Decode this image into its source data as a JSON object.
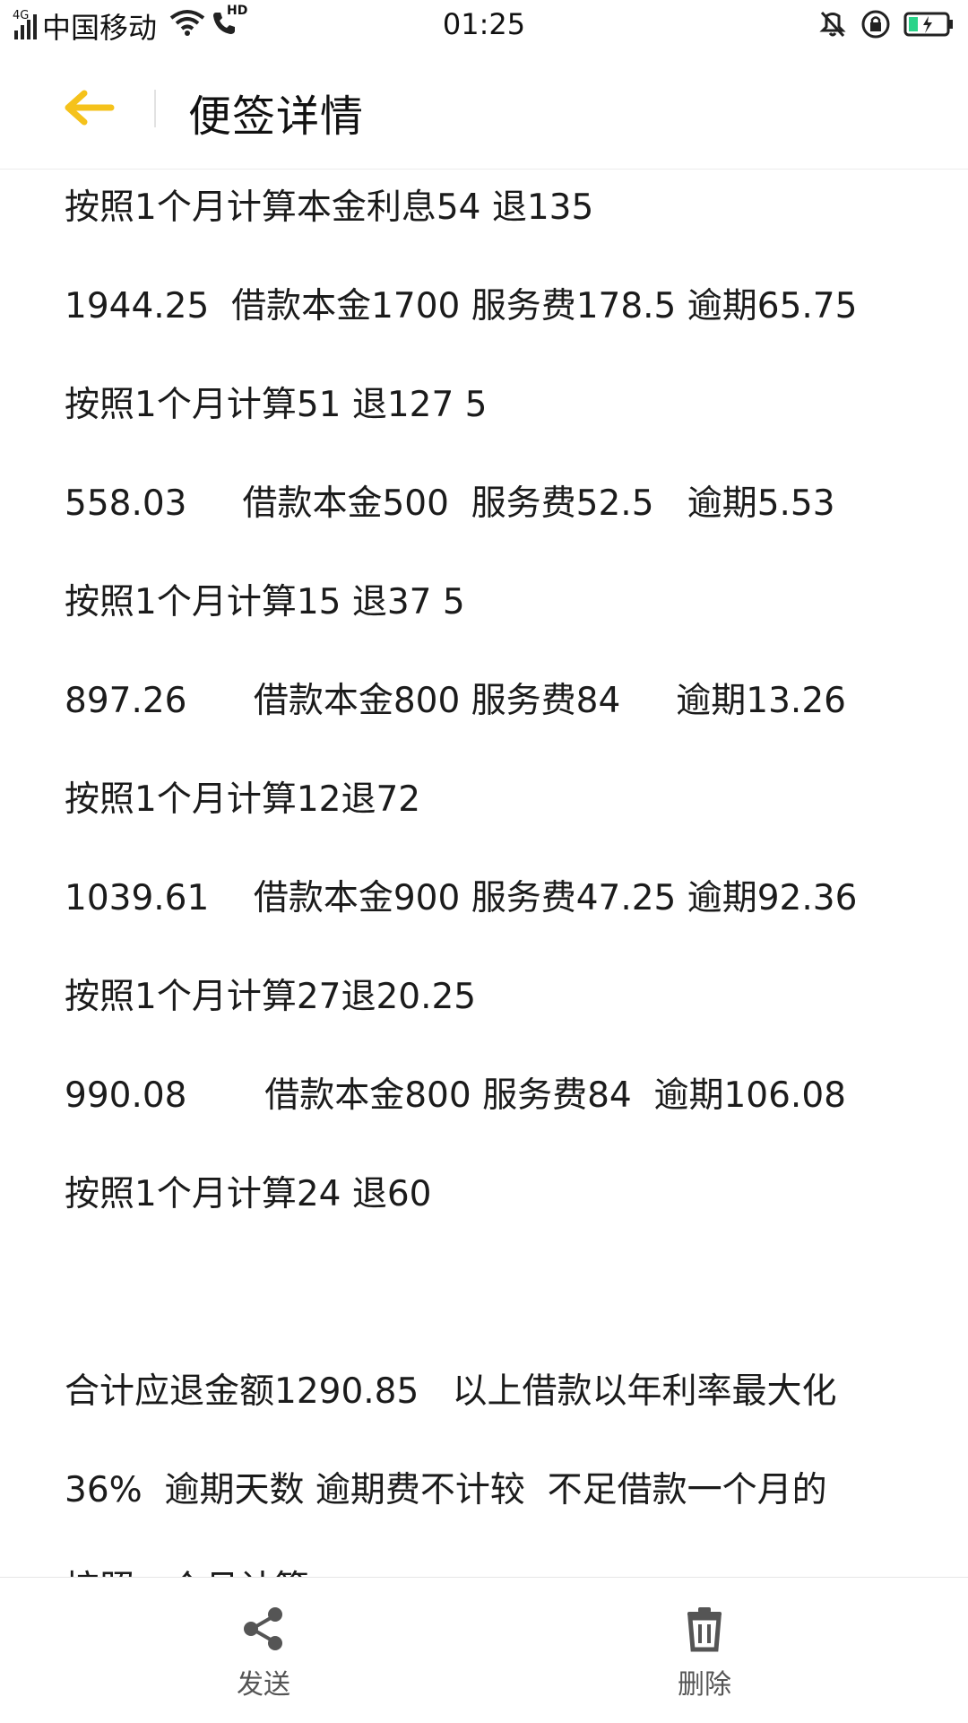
{
  "status_bar": {
    "network_type": "4G",
    "carrier": "中国移动",
    "hd_label": "HD",
    "time": "01:25",
    "icons": [
      "signal-icon",
      "wifi-icon",
      "hd-call-icon",
      "mute-icon",
      "rotation-lock-icon",
      "battery-charging-icon"
    ],
    "battery_color": "#2bd48a"
  },
  "header": {
    "title": "便签详情",
    "back_icon": "arrow-left-icon",
    "accent_color": "#f5c21b"
  },
  "note": {
    "lines": [
      "按照1个月计算本金利息54 退135",
      "1944.25  借款本金1700 服务费178.5 逾期65.75",
      "按照1个月计算51 退127 5",
      "558.03     借款本金500  服务费52.5   逾期5.53",
      "按照1个月计算15 退37 5",
      "897.26      借款本金800 服务费84     逾期13.26",
      "按照1个月计算12退72",
      "1039.61    借款本金900 服务费47.25 逾期92.36",
      "按照1个月计算27退20.25",
      "990.08       借款本金800 服务费84  逾期106.08",
      "按照1个月计算24 退60",
      "",
      "合计应退金额1290.85   以上借款以年利率最大化",
      "36%  逾期天数 逾期费不计较  不足借款一个月的",
      "按照一个月计算"
    ]
  },
  "bottom_bar": {
    "send_label": "发送",
    "delete_label": "删除",
    "send_icon": "share-icon",
    "delete_icon": "trash-icon"
  }
}
